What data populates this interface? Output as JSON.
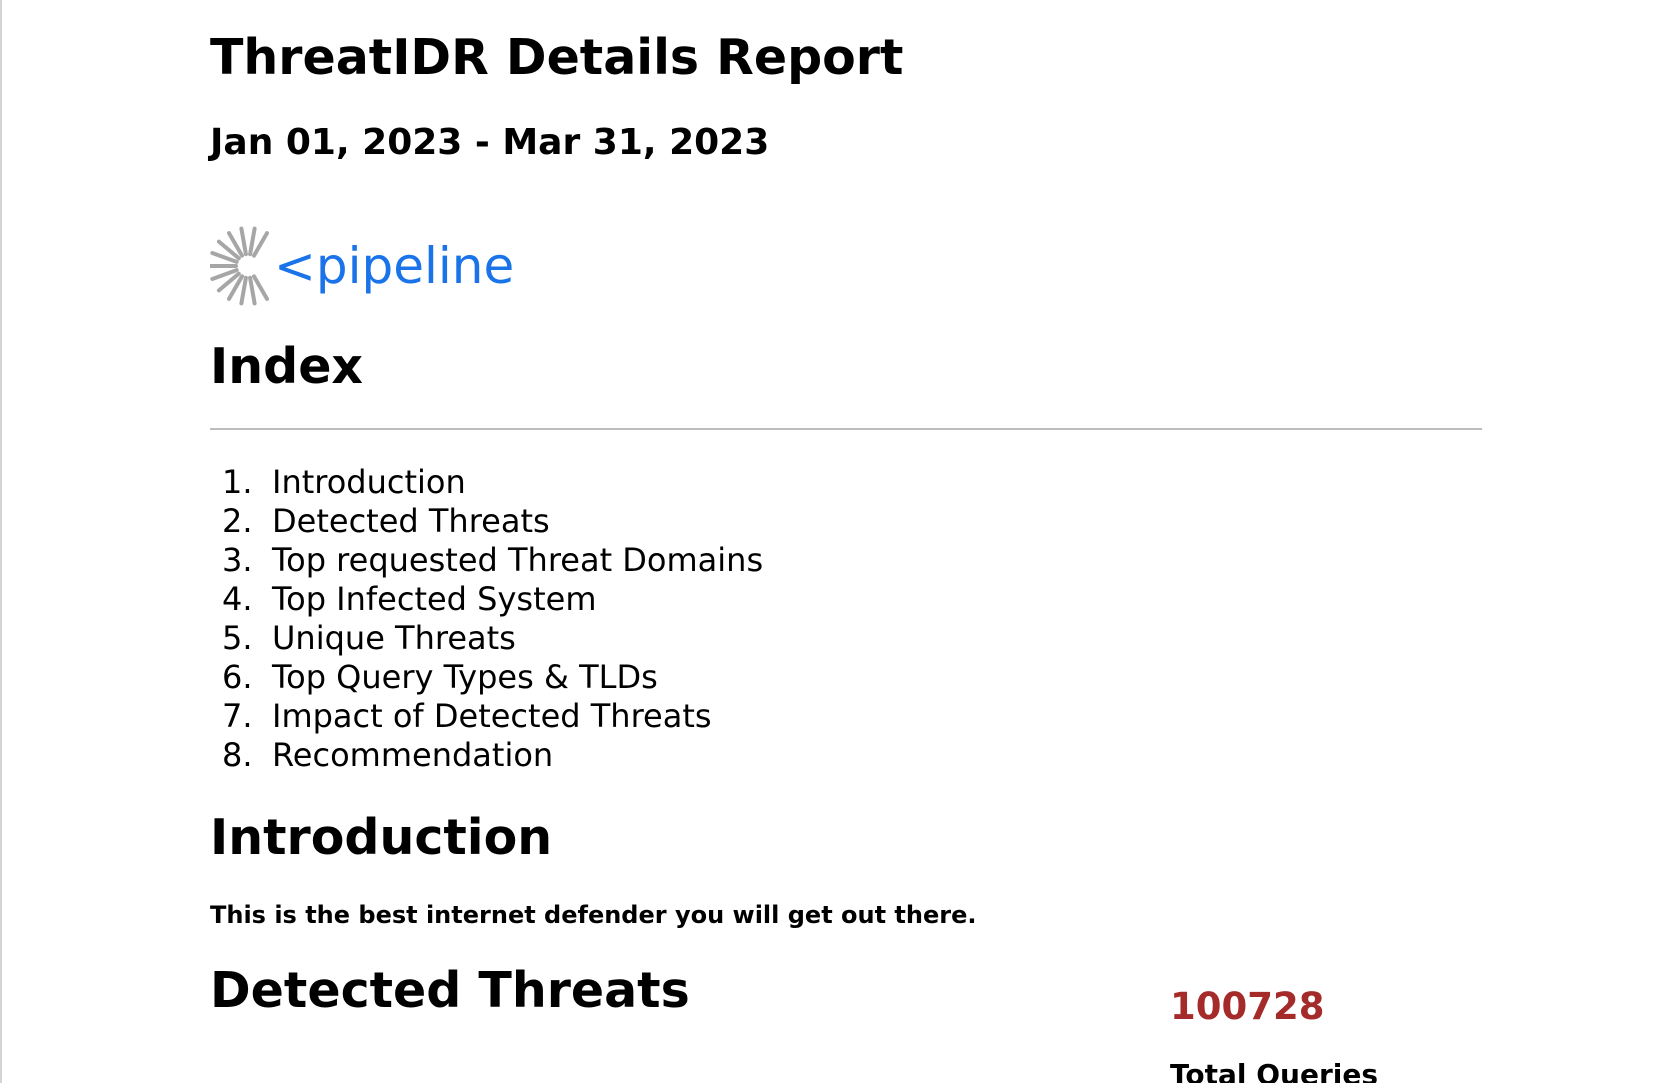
{
  "report": {
    "title": "ThreatIDR Details Report",
    "date_range": "Jan 01, 2023 - Mar 31, 2023"
  },
  "logo": {
    "text": "<pipeline",
    "icon": "starburst-icon",
    "text_color": "#1a73e8",
    "icon_color": "#a6a6a6"
  },
  "index": {
    "heading": "Index",
    "items": [
      {
        "number": "1.",
        "label": "Introduction"
      },
      {
        "number": "2.",
        "label": "Detected Threats"
      },
      {
        "number": "3.",
        "label": "Top requested Threat Domains"
      },
      {
        "number": "4.",
        "label": "Top Infected System"
      },
      {
        "number": "5.",
        "label": "Unique Threats"
      },
      {
        "number": "6.",
        "label": "Top Query Types & TLDs"
      },
      {
        "number": "7.",
        "label": "Impact of Detected Threats"
      },
      {
        "number": "8.",
        "label": "Recommendation"
      }
    ]
  },
  "introduction": {
    "heading": "Introduction",
    "text": "This is the best internet defender you will get out there."
  },
  "detected_threats": {
    "heading": "Detected Threats",
    "total_queries": {
      "value": "100728",
      "label": "Total Queries",
      "color": "#a52a2a"
    }
  }
}
